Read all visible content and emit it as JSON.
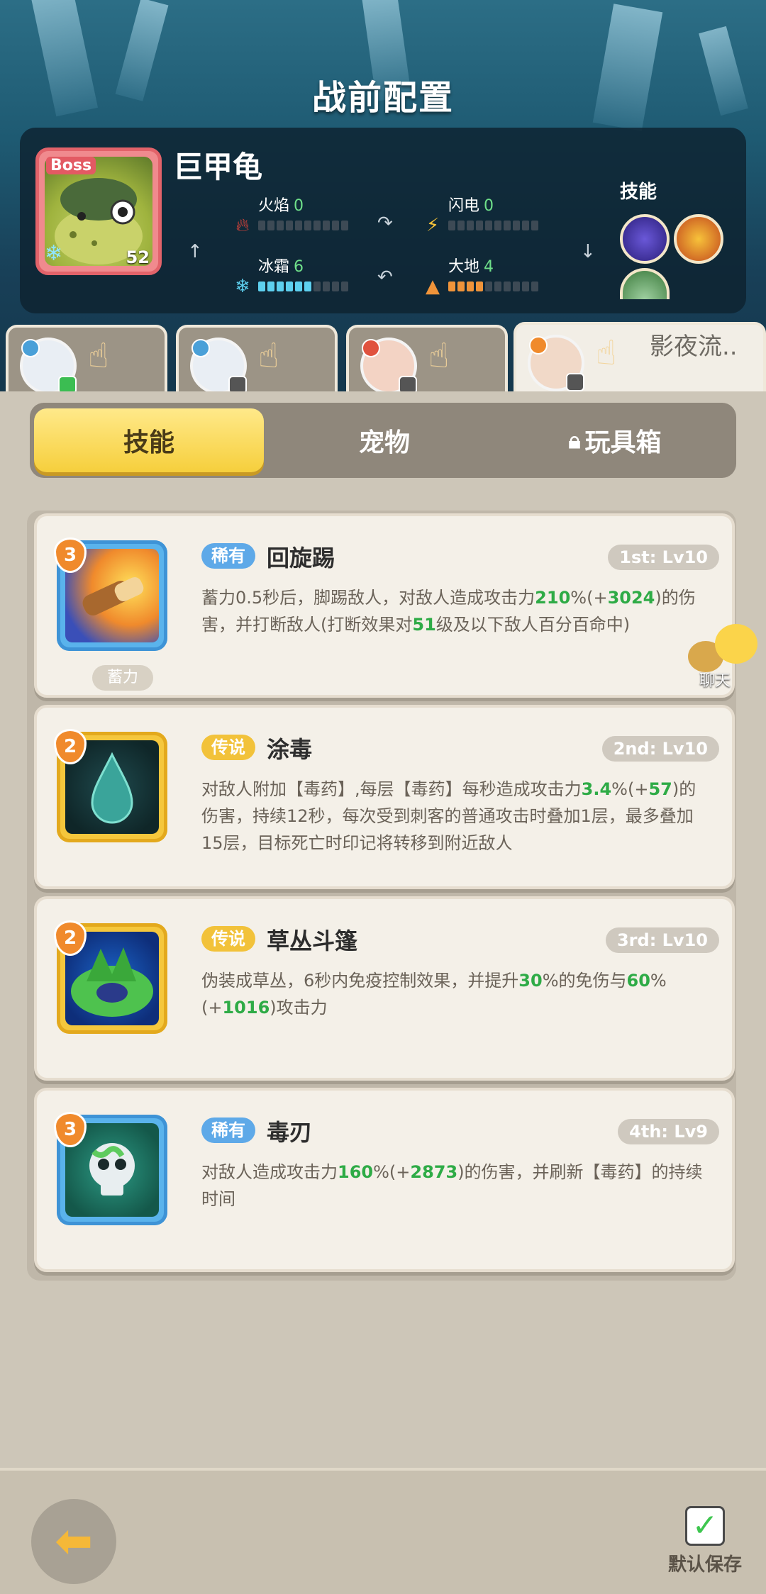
{
  "header": {
    "title": "战前配置"
  },
  "boss": {
    "tag": "Boss",
    "name": "巨甲龟",
    "level": "52",
    "stats": [
      {
        "label": "火焰",
        "value": "0",
        "icon": "fire-icon",
        "color": "#f0943a",
        "level": 0
      },
      {
        "label": "闪电",
        "value": "0",
        "icon": "lightning-icon",
        "color": "#f6c33a",
        "level": 0
      },
      {
        "label": "冰霜",
        "value": "6",
        "icon": "snowflake-icon",
        "color": "#5ed0ef",
        "level": 6
      },
      {
        "label": "大地",
        "value": "4",
        "icon": "earth-icon",
        "color": "#f0943a",
        "level": 4
      }
    ],
    "skills_label": "技能"
  },
  "heroes": [
    {
      "name": "",
      "element": "ice",
      "badge": "green"
    },
    {
      "name": "",
      "element": "wind",
      "badge": "dark"
    },
    {
      "name": "",
      "element": "fire",
      "badge": "dark"
    },
    {
      "name": "影夜流..",
      "element": "fire",
      "badge": "dark",
      "active": true
    }
  ],
  "tabs": [
    {
      "label": "技能",
      "active": true
    },
    {
      "label": "宠物",
      "active": false
    },
    {
      "label": "玩具箱",
      "active": false,
      "locked": true
    }
  ],
  "skills": [
    {
      "level_badge": "3",
      "rarity": "稀有",
      "rarity_type": "rare",
      "name": "回旋踢",
      "slot": "1st: Lv10",
      "sub_tag": "蓄力",
      "frame": "blue",
      "icon": "kick-icon",
      "desc_parts": [
        "蓄力0.5秒后，脚踢敌人，对敌人造成攻击力",
        "210",
        "%(+",
        "3024",
        ")的伤害，并打断敌人(打断效果对",
        "51",
        "级及以下敌人百分百命中)"
      ]
    },
    {
      "level_badge": "2",
      "rarity": "传说",
      "rarity_type": "legend",
      "name": "涂毒",
      "slot": "2nd: Lv10",
      "sub_tag": "",
      "frame": "gold",
      "icon": "poison-drop-icon",
      "desc_parts": [
        "对敌人附加【毒药】,每层【毒药】每秒造成攻击力",
        "3.4",
        "%(+",
        "57",
        ")的伤害，持续12秒，每次受到刺客的普通攻击时叠加1层，最多叠加15层，目标死亡时印记将转移到附近敌人"
      ]
    },
    {
      "level_badge": "2",
      "rarity": "传说",
      "rarity_type": "legend",
      "name": "草丛斗篷",
      "slot": "3rd: Lv10",
      "sub_tag": "",
      "frame": "gold",
      "icon": "bush-cloak-icon",
      "desc_parts": [
        "伪装成草丛，6秒内免疫控制效果，并提升",
        "30",
        "%的免伤与",
        "60",
        "%(+",
        "1016",
        ")攻击力"
      ]
    },
    {
      "level_badge": "3",
      "rarity": "稀有",
      "rarity_type": "rare",
      "name": "毒刃",
      "slot": "4th: Lv9",
      "sub_tag": "",
      "frame": "blue",
      "icon": "poison-skull-icon",
      "desc_parts": [
        "对敌人造成攻击力",
        "160",
        "%(+",
        "2873",
        ")的伤害，并刷新【毒药】的持续时间"
      ]
    }
  ],
  "chat": {
    "label": "聊天"
  },
  "footer": {
    "save_label": "默认保存"
  }
}
